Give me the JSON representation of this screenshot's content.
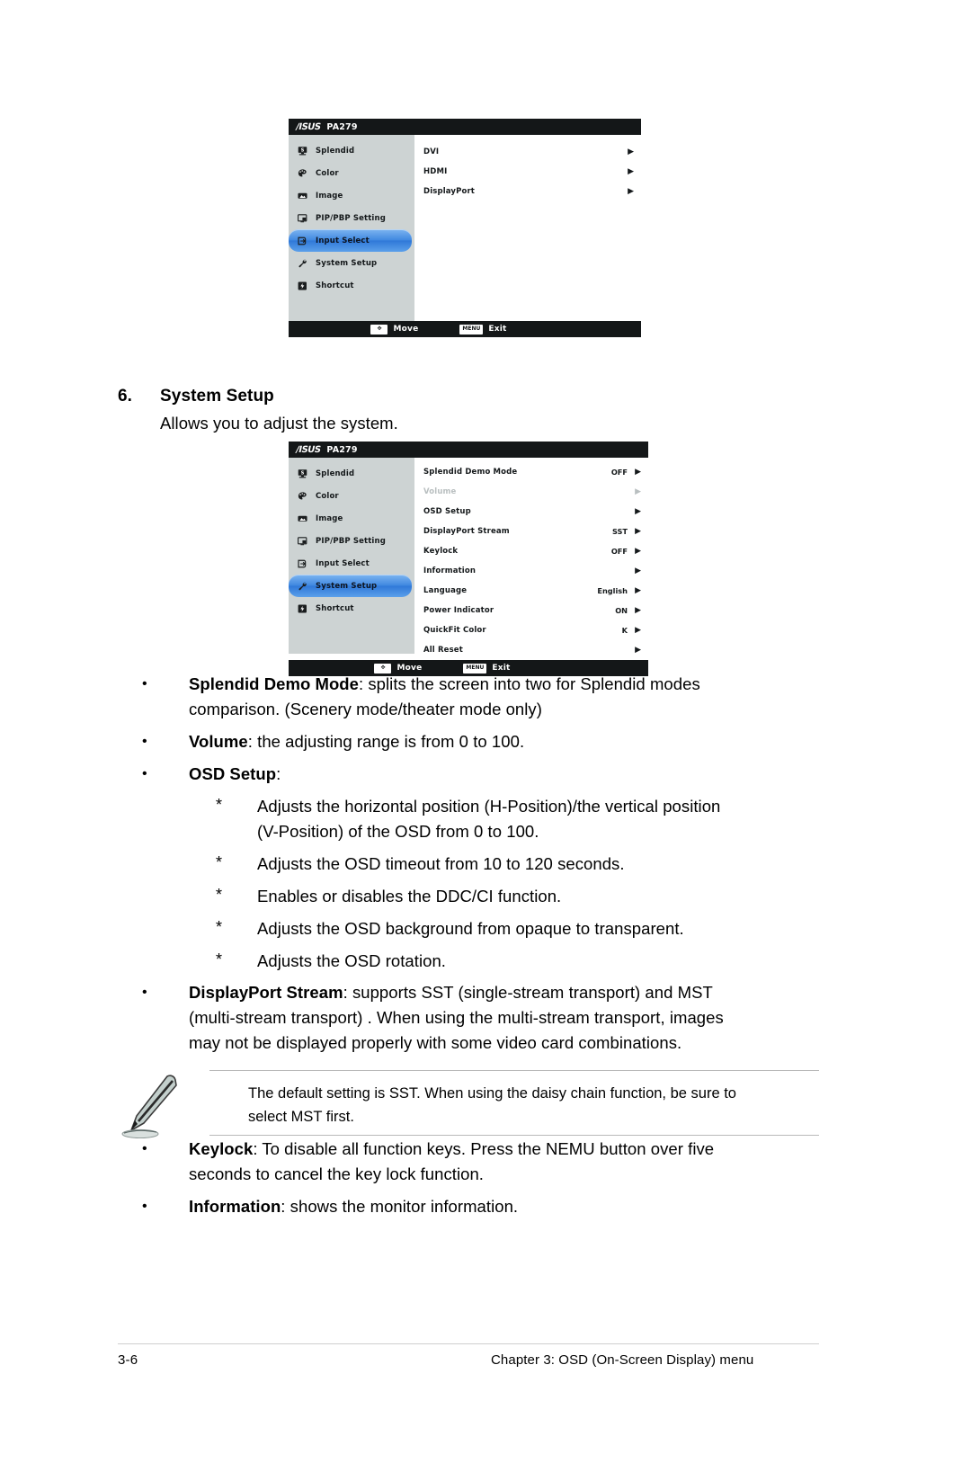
{
  "osd_menu_1": {
    "model": "PA279",
    "brand": "/ISUS",
    "sidebar": [
      {
        "label": "Splendid",
        "icon": "splendid-icon",
        "selected": false
      },
      {
        "label": "Color",
        "icon": "palette-icon",
        "selected": false
      },
      {
        "label": "Image",
        "icon": "image-icon",
        "selected": false
      },
      {
        "label": "PIP/PBP Setting",
        "icon": "pip-pbp-icon",
        "selected": false
      },
      {
        "label": "Input Select",
        "icon": "input-icon",
        "selected": true
      },
      {
        "label": "System Setup",
        "icon": "wrench-icon",
        "selected": false
      },
      {
        "label": "Shortcut",
        "icon": "shortcut-icon",
        "selected": false
      }
    ],
    "options": [
      {
        "name": "DVI",
        "value": "",
        "arrow": "▶",
        "disabled": false
      },
      {
        "name": "HDMI",
        "value": "",
        "arrow": "▶",
        "disabled": false
      },
      {
        "name": "DisplayPort",
        "value": "",
        "arrow": "▶",
        "disabled": false
      }
    ],
    "footer": {
      "move_key": "✥",
      "move_label": "Move",
      "exit_key": "MENU",
      "exit_label": "Exit"
    }
  },
  "osd_menu_2": {
    "model": "PA279",
    "brand": "/ISUS",
    "sidebar": [
      {
        "label": "Splendid",
        "icon": "splendid-icon",
        "selected": false
      },
      {
        "label": "Color",
        "icon": "palette-icon",
        "selected": false
      },
      {
        "label": "Image",
        "icon": "image-icon",
        "selected": false
      },
      {
        "label": "PIP/PBP Setting",
        "icon": "pip-pbp-icon",
        "selected": false
      },
      {
        "label": "Input Select",
        "icon": "input-icon",
        "selected": false
      },
      {
        "label": "System Setup",
        "icon": "wrench-icon",
        "selected": true
      },
      {
        "label": "Shortcut",
        "icon": "shortcut-icon",
        "selected": false
      }
    ],
    "options": [
      {
        "name": "Splendid Demo Mode",
        "value": "OFF",
        "arrow": "▶",
        "disabled": false
      },
      {
        "name": "Volume",
        "value": "",
        "arrow": "▶",
        "disabled": true
      },
      {
        "name": "OSD Setup",
        "value": "",
        "arrow": "▶",
        "disabled": false
      },
      {
        "name": "DisplayPort Stream",
        "value": "SST",
        "arrow": "▶",
        "disabled": false
      },
      {
        "name": "Keylock",
        "value": "OFF",
        "arrow": "▶",
        "disabled": false
      },
      {
        "name": "Information",
        "value": "",
        "arrow": "▶",
        "disabled": false
      },
      {
        "name": "Language",
        "value": "English",
        "arrow": "▶",
        "disabled": false
      },
      {
        "name": "Power Indicator",
        "value": "ON",
        "arrow": "▶",
        "disabled": false
      },
      {
        "name": "QuickFit Color",
        "value": "K",
        "arrow": "▶",
        "disabled": false
      },
      {
        "name": "All Reset",
        "value": "",
        "arrow": "▶",
        "disabled": false
      }
    ],
    "footer": {
      "move_key": "✥",
      "move_label": "Move",
      "exit_key": "MENU",
      "exit_label": "Exit"
    }
  },
  "section": {
    "number": "6.",
    "title": "System Setup",
    "intro": "Allows you to adjust the system."
  },
  "bullets": {
    "b1_term": "Splendid Demo Mode",
    "b1_line1_rest": ": splits the screen into two for Splendid modes",
    "b1_line2": "comparison. (Scenery mode/theater mode only)",
    "b2_term": "Volume",
    "b2_rest": ": the adjusting range is from 0 to 100.",
    "b3_term": "OSD Setup",
    "b3_rest": ":",
    "b4_term": "DisplayPort Stream",
    "b4_line1_rest": ": supports SST (single-stream transport) and MST",
    "b4_line2": "(multi-stream transport) . When using the multi-stream transport, images",
    "b4_line3": "may not be displayed properly with some video card combinations.",
    "b5_term": "Keylock",
    "b5_line1_rest": ": To disable all function keys. Press the NEMU button over five",
    "b5_line2": "seconds to cancel the key lock function.",
    "b6_term": "Information",
    "b6_rest": ": shows the monitor information.",
    "dot": "•",
    "star": "*"
  },
  "sub_bullets": [
    {
      "line1": "Adjusts the horizontal position (H-Position)/the vertical position",
      "line2": "(V-Position) of the OSD from 0 to 100."
    },
    {
      "line1": "Adjusts the OSD timeout from 10 to 120 seconds.",
      "line2": ""
    },
    {
      "line1": "Enables or disables the DDC/CI function.",
      "line2": ""
    },
    {
      "line1": "Adjusts the OSD background from opaque to transparent.",
      "line2": ""
    },
    {
      "line1": "Adjusts the OSD rotation.",
      "line2": ""
    }
  ],
  "note": {
    "line1": "The default setting is SST. When using the daisy chain function, be sure to",
    "line2": "select MST first."
  },
  "footer": {
    "page_number": "3-6",
    "chapter": "Chapter 3: OSD (On-Screen Display) menu"
  }
}
